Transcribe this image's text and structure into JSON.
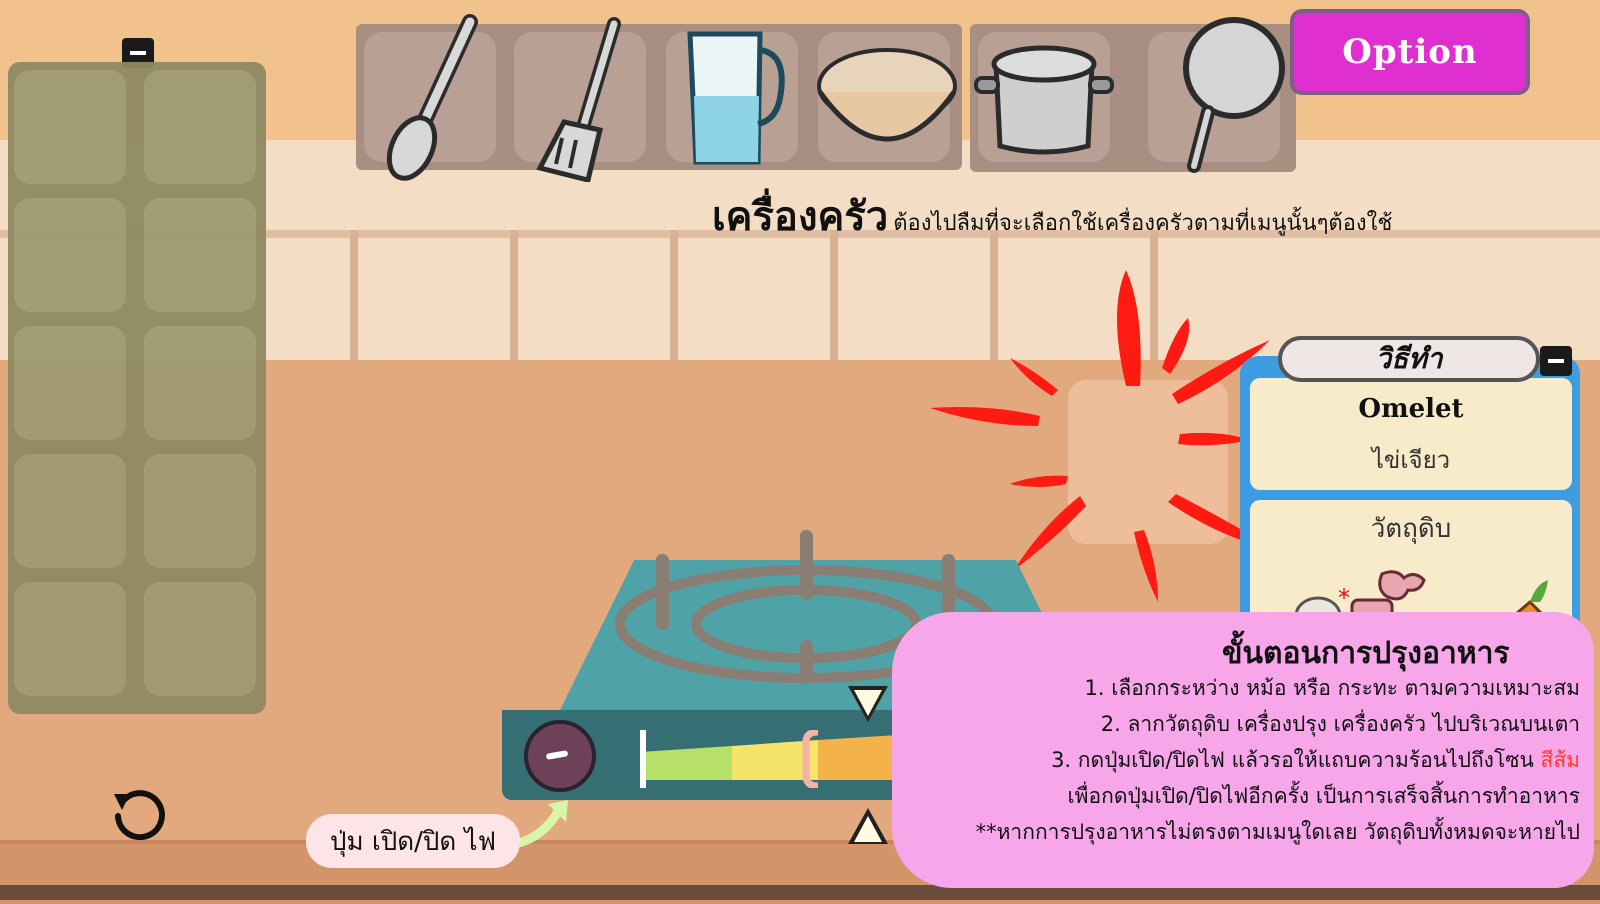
{
  "toolbar": {
    "tools": [
      {
        "name": "spoon"
      },
      {
        "name": "spatula"
      },
      {
        "name": "water-pitcher"
      },
      {
        "name": "rice-bowl"
      },
      {
        "name": "pot"
      },
      {
        "name": "frying-pan"
      }
    ]
  },
  "option_button": {
    "label": "Option"
  },
  "caption": {
    "title": "เครื่องครัว",
    "text": "ต้องไปลืมที่จะเลือกใช้เครื่องครัวตามที่เมนูนั้นๆต้องใช้"
  },
  "stove": {
    "knob_label": "ปุ่ม เปิด/ปิด ไฟ",
    "heat_bar": {
      "zones": [
        "green",
        "yellow",
        "orange",
        "red"
      ],
      "colors": {
        "green": "#b6e06a",
        "yellow": "#f6e36a",
        "orange": "#f4b24a",
        "red": "#d64540"
      },
      "target_zone": "orange"
    }
  },
  "recipe": {
    "tab": "วิธีทำ",
    "dish_en": "Omelet",
    "dish_th": "ไข่เจียว",
    "ingredients_label": "วัตถุดิบ"
  },
  "instructions": {
    "title": "ขั้นตอนการปรุงอาหาร",
    "lines": [
      "1. เลือกกระหว่าง หม้อ หรือ กระทะ ตามความเหมาะสม",
      "2. ลากวัตถุดิบ เครื่องปรุง เครื่องครัว ไปบริเวณบนเตา",
      "3. กดปุ่มเปิด/ปิดไฟ แล้วรอให้แถบความร้อนไปถึงโซน",
      "เพื่อกดปุ่มเปิด/ปิดไฟอีกครั้ง เป็นการเสร็จสิ้นการทำอาหาร",
      "**หากการปรุงอาหารไม่ตรงตามเมนูใดเลย วัตถุดิบทั้งหมดจะหายไป"
    ],
    "highlight": "สีส้ม"
  },
  "colors": {
    "option": "#e02fd0",
    "burst": "#ff1a12",
    "recipe_border": "#3d9de0",
    "instructions_bg": "#f7a6ea"
  }
}
